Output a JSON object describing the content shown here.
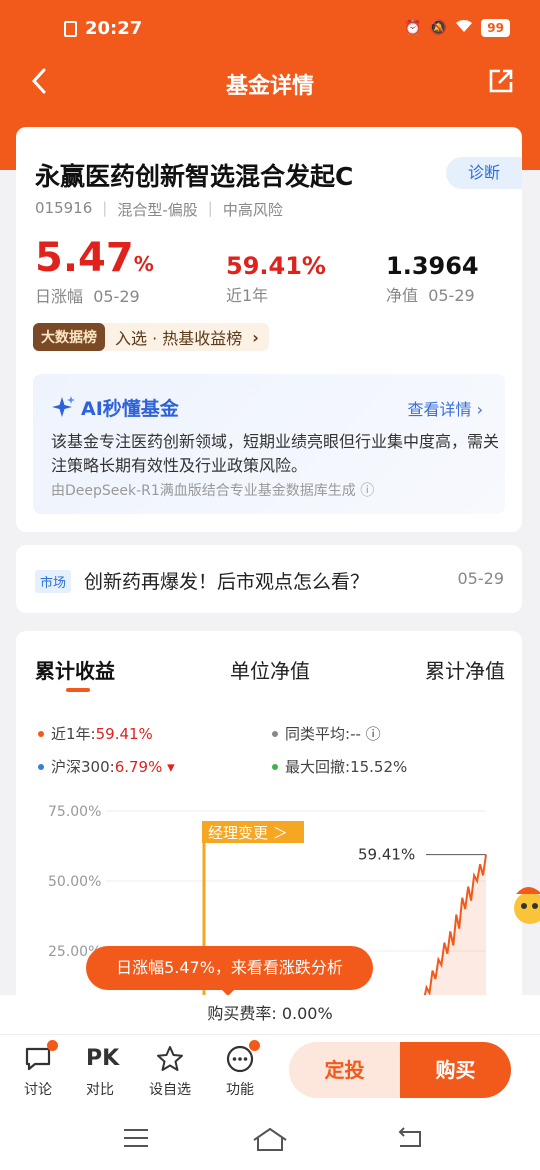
{
  "status": {
    "time": "20:27",
    "battery": "99"
  },
  "header": {
    "title": "基金详情"
  },
  "fund": {
    "name": "永赢医药创新智选混合发起C",
    "diagnose_label": "诊断",
    "code": "015916",
    "type": "混合型-偏股",
    "risk": "中高风险",
    "daily_change": "5.47",
    "daily_change_unit": "%",
    "daily_label": "日涨幅",
    "daily_date": "05-29",
    "year_return": "59.41%",
    "year_label": "近1年",
    "nav": "1.3964",
    "nav_label": "净值",
    "nav_date": "05-29"
  },
  "bigdata": {
    "badge": "大数据榜",
    "text": "入选 · 热基收益榜",
    "chevron": "›"
  },
  "ai": {
    "title": "AI秒懂基金",
    "more": "查看详情 ›",
    "desc": "该基金专注医药创新领域，短期业绩亮眼但行业集中度高，需关注策略长期有效性及行业政策风险。",
    "source": "由DeepSeek-R1满血版结合专业基金数据库生成 ⓘ"
  },
  "news": {
    "tag": "市场",
    "text": "创新药再爆发！后市观点怎么看？",
    "date": "05-29"
  },
  "chart_tabs": [
    "累计收益",
    "单位净值",
    "累计净值"
  ],
  "legend": {
    "near1y": "近1年:",
    "near1y_val": "59.41%",
    "peer": "同类平均:",
    "peer_val": "-- ⓘ",
    "hs300": "沪深300:",
    "hs300_val": "6.79% ▾",
    "maxdd": "最大回撤:",
    "maxdd_val": "15.52%"
  },
  "chart_labels": {
    "manager_change": "经理变更 ＞",
    "end_label": "59.41%"
  },
  "chart_data": {
    "type": "line",
    "ylabel": "",
    "yticks": [
      "75.00%",
      "50.00%",
      "25.00%"
    ],
    "ylim": [
      0,
      75
    ],
    "series": [
      {
        "name": "近1年",
        "color": "#f25a1b",
        "values": [
          0,
          1,
          2,
          0,
          3,
          1,
          2,
          0,
          1,
          3,
          2,
          4,
          3,
          6,
          4,
          8,
          7,
          12,
          10,
          18,
          15,
          22,
          20,
          28,
          24,
          32,
          27,
          38,
          33,
          44,
          40,
          48,
          43,
          52,
          50,
          56,
          52,
          59.41
        ]
      }
    ]
  },
  "toast": "日涨幅5.47%，来看看涨跌分析",
  "fee": {
    "label": "购买费率:",
    "value": "0.00%"
  },
  "bottom": {
    "discuss": "讨论",
    "compare": "对比",
    "compare_icon": "PK",
    "watchlist": "设自选",
    "functions": "功能",
    "dingtou": "定投",
    "buy": "购买"
  }
}
